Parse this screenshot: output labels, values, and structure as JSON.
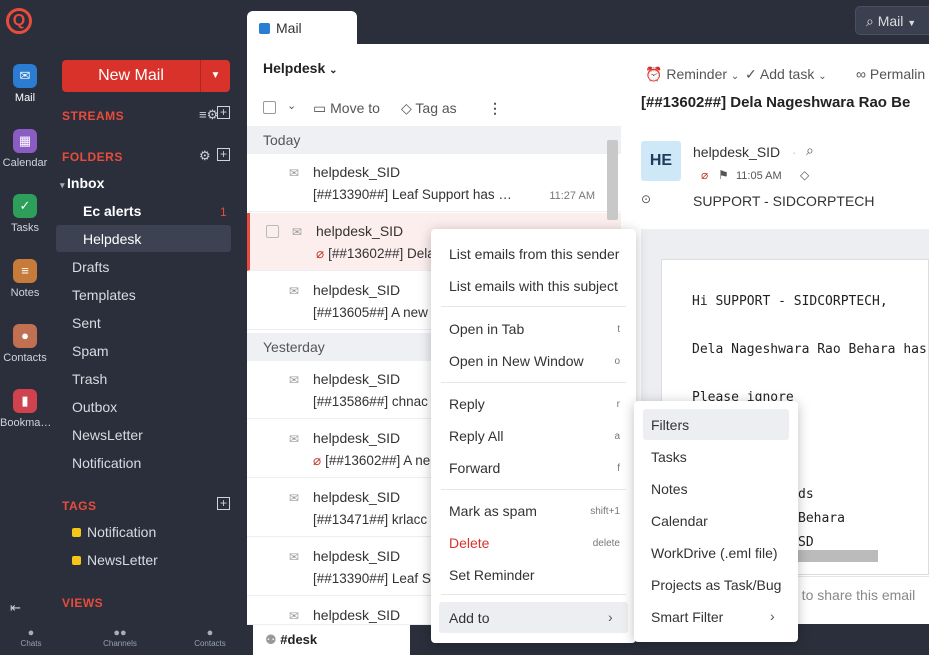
{
  "top": {
    "tab_label": "Mail",
    "search_label": "Mail"
  },
  "rail": [
    {
      "label": "Mail",
      "icon": "mail-icon",
      "color": "#2b7cd3"
    },
    {
      "label": "Calendar",
      "icon": "calendar-icon",
      "color": "#8a5cc4"
    },
    {
      "label": "Tasks",
      "icon": "check-icon",
      "color": "#2e9e5b"
    },
    {
      "label": "Notes",
      "icon": "notes-icon",
      "color": "#c77b3b"
    },
    {
      "label": "Contacts",
      "icon": "contact-icon",
      "color": "#c27052"
    },
    {
      "label": "Bookma…",
      "icon": "bookmark-icon",
      "color": "#d0434e"
    }
  ],
  "folders": {
    "new_mail": "New Mail",
    "streams": "STREAMS",
    "folders_label": "FOLDERS",
    "inbox": "Inbox",
    "ec_alerts": "Ec alerts",
    "ec_alerts_count": "1",
    "helpdesk": "Helpdesk",
    "items": [
      "Drafts",
      "Templates",
      "Sent",
      "Spam",
      "Trash",
      "Outbox",
      "NewsLetter",
      "Notification"
    ],
    "tags_label": "TAGS",
    "tags": [
      "Notification",
      "NewsLetter"
    ],
    "views_label": "VIEWS"
  },
  "list": {
    "title": "Helpdesk",
    "move_to": "Move to",
    "tag_as": "Tag as",
    "today": "Today",
    "yesterday": "Yesterday",
    "rows": [
      {
        "from": "helpdesk_SID",
        "subject": "[##13390##] Leaf Support has …",
        "time": "11:27 AM"
      },
      {
        "from": "helpdesk_SID",
        "subject": "[##13602##] Dela",
        "time": ""
      },
      {
        "from": "helpdesk_SID",
        "subject": "[##13605##] A new",
        "time": ""
      },
      {
        "from": "helpdesk_SID",
        "subject": "[##13586##] chnac",
        "time": ""
      },
      {
        "from": "helpdesk_SID",
        "subject": "[##13602##] A ne",
        "time": ""
      },
      {
        "from": "helpdesk_SID",
        "subject": "[##13471##] krlacc",
        "time": ""
      },
      {
        "from": "helpdesk_SID",
        "subject": "[##13390##] Leaf S",
        "time": ""
      },
      {
        "from": "helpdesk_SID",
        "subject": "",
        "time": ""
      }
    ]
  },
  "pane": {
    "reminder": "Reminder",
    "add_task": "Add task",
    "permalink": "Permalin",
    "subject": "[##13602##]  Dela Nageshwara Rao Be",
    "avatar": "HE",
    "from": "helpdesk_SID",
    "time": "11:05 AM",
    "to": "SUPPORT - SIDCORPTECH",
    "body": [
      "Hi SUPPORT - SIDCORPTECH,",
      "Dela Nageshwara Rao Behara has re",
      "Please ignore",
      "ds",
      "Behara",
      "SD"
    ],
    "share": "p to share this email"
  },
  "bottom": {
    "chats": "Chats",
    "channels": "Channels",
    "contacts": "Contacts",
    "channel_name": "#desk"
  },
  "menu": {
    "list_sender": "List emails from this sender",
    "list_subject": "List emails with this subject",
    "open_tab": "Open in Tab",
    "open_tab_key": "t",
    "open_window": "Open in New Window",
    "open_window_key": "o",
    "reply": "Reply",
    "reply_key": "r",
    "reply_all": "Reply All",
    "reply_all_key": "a",
    "forward": "Forward",
    "forward_key": "f",
    "spam": "Mark as spam",
    "spam_key": "shift+1",
    "delete": "Delete",
    "delete_key": "delete",
    "reminder": "Set Reminder",
    "add_to": "Add to"
  },
  "submenu": [
    "Filters",
    "Tasks",
    "Notes",
    "Calendar",
    "WorkDrive (.eml file)",
    "Projects as Task/Bug",
    "Smart Filter"
  ]
}
